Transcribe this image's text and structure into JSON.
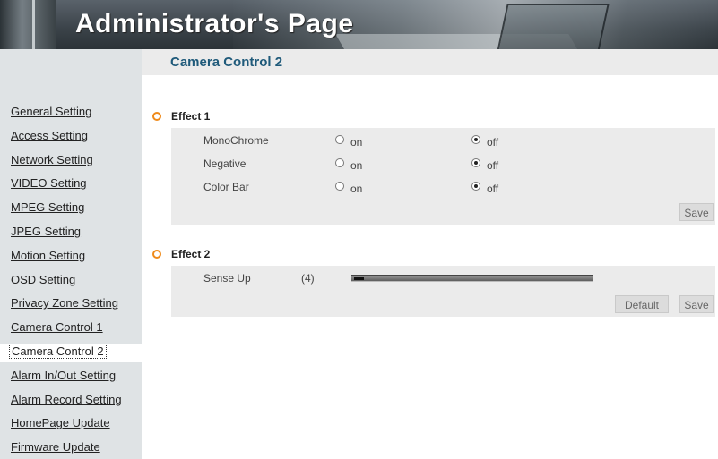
{
  "header": {
    "title": "Administrator's Page"
  },
  "page": {
    "title": "Camera Control 2"
  },
  "sidebar": {
    "items": [
      {
        "label": "General Setting"
      },
      {
        "label": "Access Setting"
      },
      {
        "label": "Network Setting"
      },
      {
        "label": "VIDEO Setting"
      },
      {
        "label": "MPEG Setting"
      },
      {
        "label": "JPEG Setting"
      },
      {
        "label": "Motion Setting"
      },
      {
        "label": "OSD Setting"
      },
      {
        "label": "Privacy Zone Setting"
      },
      {
        "label": "Camera Control 1"
      },
      {
        "label": "Camera Control 2",
        "active": true
      },
      {
        "label": "Alarm In/Out Setting"
      },
      {
        "label": "Alarm Record Setting"
      },
      {
        "label": "HomePage Update"
      },
      {
        "label": "Firmware Update"
      }
    ]
  },
  "effect1": {
    "title": "Effect 1",
    "rows": [
      {
        "label": "MonoChrome",
        "on_label": "on",
        "off_label": "off",
        "selected": "off"
      },
      {
        "label": "Negative",
        "on_label": "on",
        "off_label": "off",
        "selected": "off"
      },
      {
        "label": "Color Bar",
        "on_label": "on",
        "off_label": "off",
        "selected": "off"
      }
    ],
    "save_label": "Save"
  },
  "effect2": {
    "title": "Effect 2",
    "sense_up": {
      "label": "Sense Up",
      "value_text": "(4)",
      "level": 0.04
    },
    "default_label": "Default",
    "save_label": "Save"
  },
  "colors": {
    "accent_bullet": "#ef8a1a",
    "title_blue": "#1f5a7a",
    "panel_bg": "#ebebeb",
    "sidebar_bg": "#dfe3e5"
  }
}
